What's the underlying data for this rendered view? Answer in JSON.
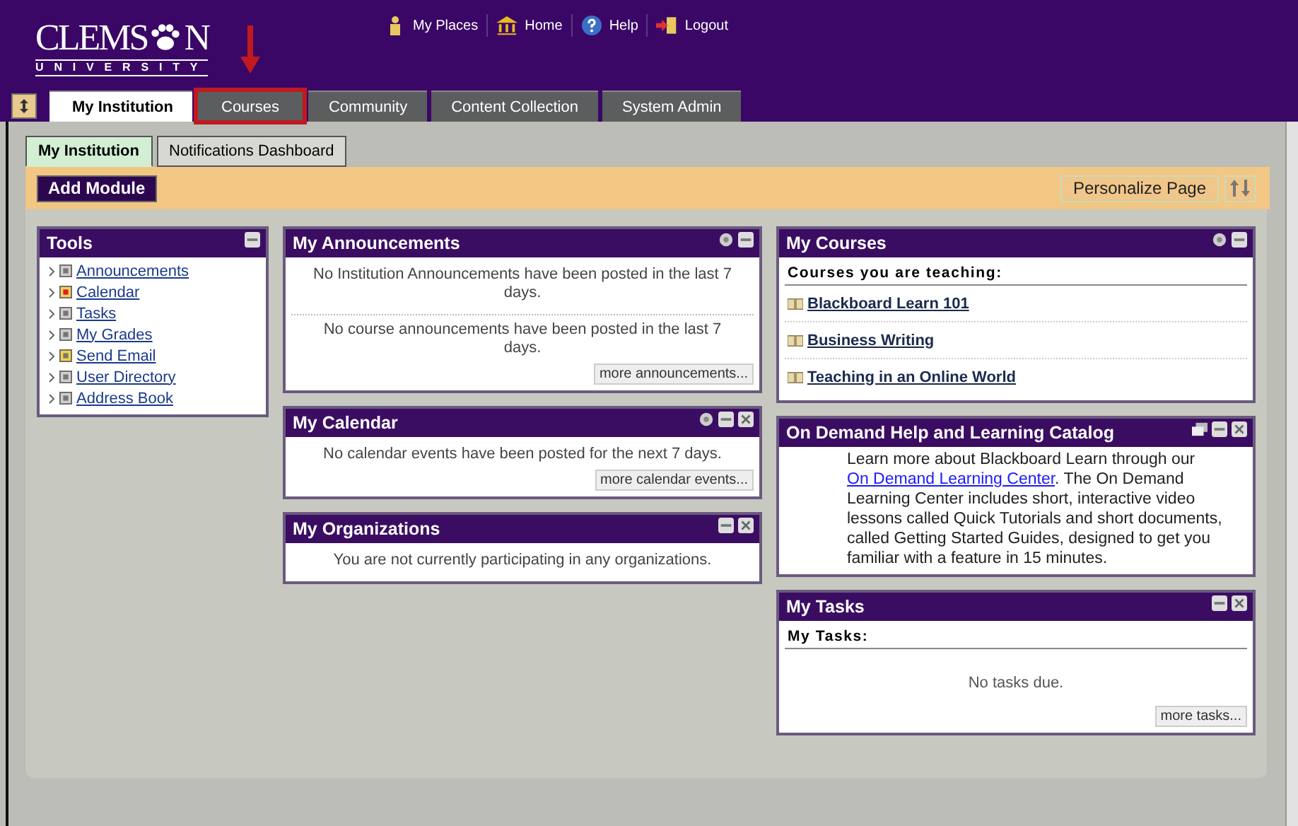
{
  "header": {
    "logo": {
      "wordmark": "CLEMS",
      "wordmark_end": "N",
      "subtitle": "U N I V E R S I T Y"
    },
    "top_links": [
      {
        "label": "My Places",
        "kind": "person"
      },
      {
        "label": "Home",
        "kind": "home"
      },
      {
        "label": "Help",
        "kind": "help"
      },
      {
        "label": "Logout",
        "kind": "logout"
      }
    ],
    "tabs": [
      {
        "label": "My Institution",
        "selected": true,
        "highlighted": false
      },
      {
        "label": "Courses",
        "selected": false,
        "highlighted": true
      },
      {
        "label": "Community",
        "selected": false,
        "highlighted": false
      },
      {
        "label": "Content Collection",
        "selected": false,
        "highlighted": false
      },
      {
        "label": "System Admin",
        "selected": false,
        "highlighted": false
      }
    ]
  },
  "subtabs": [
    {
      "label": "My Institution",
      "selected": true
    },
    {
      "label": "Notifications Dashboard",
      "selected": false
    }
  ],
  "action_bar": {
    "add_button": "Add Module",
    "personalize_button": "Personalize Page"
  },
  "columns": [
    [
      {
        "kind": "links",
        "title": "Tools",
        "items": [
          "Announcements",
          "Calendar",
          "Tasks",
          "My Grades",
          "Send Email",
          "User Directory",
          "Address Book"
        ]
      }
    ],
    [
      {
        "kind": "messages",
        "title": "My Announcements",
        "messages": [
          "No Institution Announcements have been posted in the last 7 days.",
          "No course announcements have been posted in the last 7 days."
        ],
        "more": "more announcements..."
      },
      {
        "kind": "messages",
        "title": "My Calendar",
        "messages": [
          "No calendar events have been posted for the next 7 days."
        ],
        "more": "more calendar events..."
      },
      {
        "kind": "messages",
        "title": "My Organizations",
        "messages": [
          "You are not currently participating in any organizations."
        ]
      }
    ],
    [
      {
        "kind": "courses",
        "title": "My Courses",
        "heading": "Courses you are teaching:",
        "courses": [
          "Blackboard Learn 101",
          "Business Writing",
          "Teaching in an Online World"
        ]
      },
      {
        "kind": "help",
        "title": "On Demand Help and Learning Catalog",
        "text_before": "Learn more about Blackboard Learn through our",
        "link": "On Demand Learning Center",
        "text_after": ". The On Demand Learning Center includes short, interactive video lessons called Quick Tutorials and short documents, called Getting Started Guides, designed to get you familiar with a feature in 15 minutes."
      },
      {
        "kind": "tasks",
        "title": "My Tasks",
        "heading": "My Tasks:",
        "empty": "No tasks due.",
        "more": "more tasks..."
      }
    ]
  ]
}
